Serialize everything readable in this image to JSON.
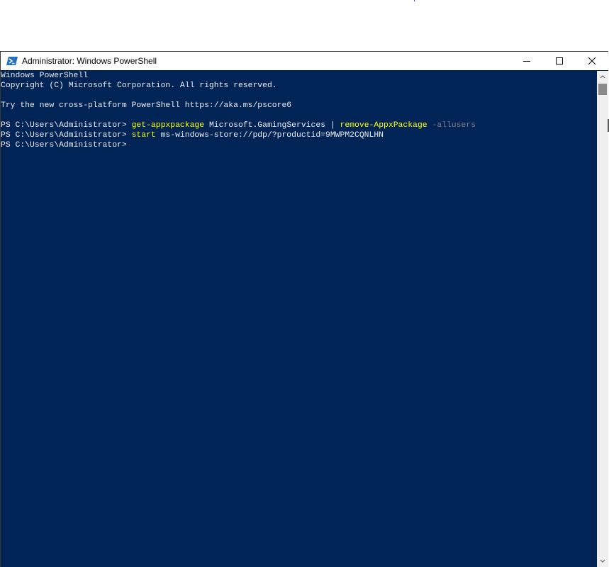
{
  "window": {
    "title": "Administrator: Windows PowerShell",
    "controls": {
      "minimize": "minimize-icon",
      "maximize": "maximize-icon",
      "close": "close-icon"
    }
  },
  "console": {
    "line0": "Windows PowerShell",
    "line1": "Copyright (C) Microsoft Corporation. All rights reserved.",
    "line2": "",
    "line3": "Try the new cross-platform PowerShell https://aka.ms/pscore6",
    "line4": "",
    "cmd1": {
      "prompt": "PS C:\\Users\\Administrator> ",
      "command": "get-appxpackage",
      "arg1": " Microsoft.GamingServices | ",
      "command2": "remove-AppxPackage",
      "space": " ",
      "param": "-allusers"
    },
    "cmd2": {
      "prompt": "PS C:\\Users\\Administrator> ",
      "command": "start",
      "arg1": " ms-windows-store://pdp/?productid=9MWPM2CQNLHN"
    },
    "cmd3": {
      "prompt": "PS C:\\Users\\Administrator>"
    }
  },
  "colors": {
    "console_bg": "#012456",
    "console_fg": "#eeedf0",
    "command": "#ffff00",
    "parameter": "#808080"
  }
}
